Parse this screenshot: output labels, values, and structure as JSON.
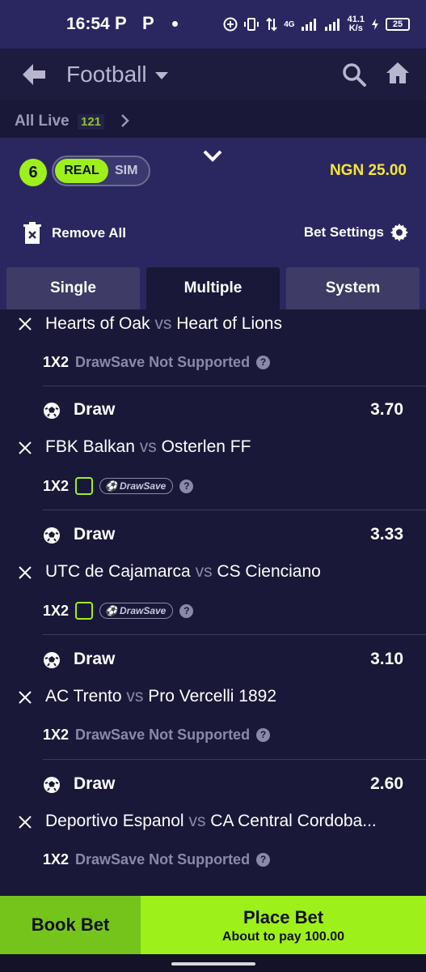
{
  "status_bar": {
    "time": "16:54",
    "notif_icons": [
      "P",
      "P"
    ],
    "network": "4G",
    "speed_value": "41.1",
    "speed_unit": "K/s",
    "battery": "25"
  },
  "header": {
    "title": "Football"
  },
  "all_live": {
    "label": "All Live",
    "count": "121"
  },
  "betslip": {
    "selections_count": "6",
    "mode_real": "REAL",
    "mode_sim": "SIM",
    "active_mode": "REAL",
    "balance": "NGN 25.00",
    "remove_all": "Remove All",
    "bet_settings": "Bet Settings",
    "tabs": [
      {
        "label": "Single",
        "active": false
      },
      {
        "label": "Multiple",
        "active": true
      },
      {
        "label": "System",
        "active": false
      }
    ]
  },
  "bets": [
    {
      "selection": "",
      "odds": "",
      "home": "Hearts of Oak",
      "vs": "vs",
      "away": "Heart of Lions",
      "market": "1X2",
      "drawsave": "DrawSave Not Supported",
      "drawsave_supported": false
    },
    {
      "selection": "Draw",
      "odds": "3.70",
      "home": "FBK Balkan",
      "vs": "vs",
      "away": "Osterlen FF",
      "market": "1X2",
      "drawsave": "DrawSave",
      "drawsave_supported": true
    },
    {
      "selection": "Draw",
      "odds": "3.33",
      "home": "UTC de Cajamarca",
      "vs": "vs",
      "away": "CS Cienciano",
      "market": "1X2",
      "drawsave": "DrawSave",
      "drawsave_supported": true
    },
    {
      "selection": "Draw",
      "odds": "3.10",
      "home": "AC Trento",
      "vs": "vs",
      "away": "Pro Vercelli 1892",
      "market": "1X2",
      "drawsave": "DrawSave Not Supported",
      "drawsave_supported": false
    },
    {
      "selection": "Draw",
      "odds": "2.60",
      "home": "Deportivo Espanol",
      "vs": "vs",
      "away": "CA Central Cordoba...",
      "market": "1X2",
      "drawsave": "DrawSave Not Supported",
      "drawsave_supported": false
    }
  ],
  "footer": {
    "book_bet": "Book Bet",
    "place_bet": "Place Bet",
    "pay_text": "About to pay 100.00"
  },
  "colors": {
    "accent_green": "#9ef01a",
    "book_green": "#75c41c",
    "balance_yellow": "#f5e53a",
    "panel_purple": "#2a2760",
    "background": "#1a1838"
  },
  "icons": [
    "back-arrow-icon",
    "caret-down-icon",
    "search-icon",
    "home-icon",
    "chevron-right-icon",
    "chevron-down-icon",
    "trash-icon",
    "gear-icon",
    "close-icon",
    "help-icon",
    "soccer-ball-icon",
    "drawsave-badge-icon"
  ]
}
